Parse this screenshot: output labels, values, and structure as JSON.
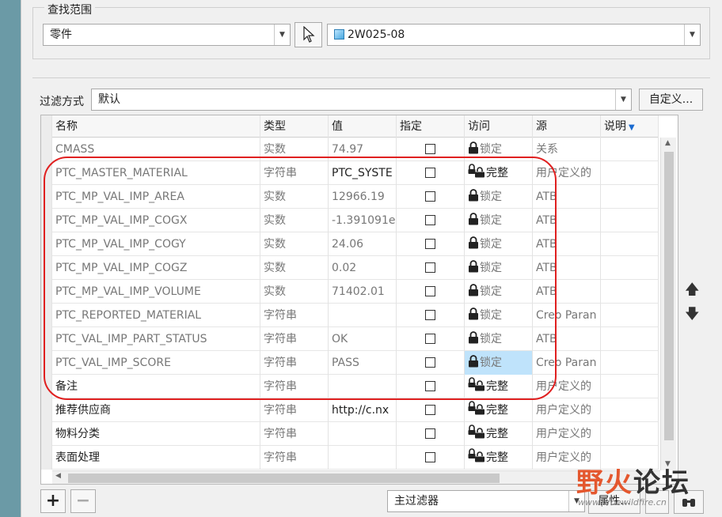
{
  "scope": {
    "legend": "查找范围",
    "type_value": "零件",
    "model_value": "2W025-08"
  },
  "filter": {
    "label": "过滤方式",
    "value": "默认",
    "customize_label": "自定义..."
  },
  "table": {
    "columns": [
      "名称",
      "类型",
      "值",
      "指定",
      "访问",
      "源",
      "说明"
    ],
    "rows": [
      {
        "name": "CMASS",
        "type": "实数",
        "value": "74.97",
        "access": "锁定",
        "locked": true,
        "source": "关系"
      },
      {
        "name": "PTC_MASTER_MATERIAL",
        "type": "字符串",
        "value": "PTC_SYSTE",
        "access": "完整",
        "locked": false,
        "source": "用户定义的"
      },
      {
        "name": "PTC_MP_VAL_IMP_AREA",
        "type": "实数",
        "value": "12966.19",
        "access": "锁定",
        "locked": true,
        "source": "ATB"
      },
      {
        "name": "PTC_MP_VAL_IMP_COGX",
        "type": "实数",
        "value": "-1.391091e",
        "access": "锁定",
        "locked": true,
        "source": "ATB"
      },
      {
        "name": "PTC_MP_VAL_IMP_COGY",
        "type": "实数",
        "value": "24.06",
        "access": "锁定",
        "locked": true,
        "source": "ATB"
      },
      {
        "name": "PTC_MP_VAL_IMP_COGZ",
        "type": "实数",
        "value": "0.02",
        "access": "锁定",
        "locked": true,
        "source": "ATB"
      },
      {
        "name": "PTC_MP_VAL_IMP_VOLUME",
        "type": "实数",
        "value": "71402.01",
        "access": "锁定",
        "locked": true,
        "source": "ATB"
      },
      {
        "name": "PTC_REPORTED_MATERIAL",
        "type": "字符串",
        "value": "",
        "access": "锁定",
        "locked": true,
        "source": "Creo Paran"
      },
      {
        "name": "PTC_VAL_IMP_PART_STATUS",
        "type": "字符串",
        "value": "OK",
        "access": "锁定",
        "locked": true,
        "source": "ATB"
      },
      {
        "name": "PTC_VAL_IMP_SCORE",
        "type": "字符串",
        "value": "PASS",
        "access": "锁定",
        "locked": true,
        "source": "Creo Paran",
        "selected": true
      },
      {
        "name": "备注",
        "type": "字符串",
        "value": "",
        "access": "完整",
        "locked": false,
        "source": "用户定义的"
      },
      {
        "name": "推荐供应商",
        "type": "字符串",
        "value": "http://c.nx",
        "access": "完整",
        "locked": false,
        "source": "用户定义的"
      },
      {
        "name": "物料分类",
        "type": "字符串",
        "value": "",
        "access": "完整",
        "locked": false,
        "source": "用户定义的"
      },
      {
        "name": "表面处理",
        "type": "字符串",
        "value": "",
        "access": "完整",
        "locked": false,
        "source": "用户定义的"
      }
    ]
  },
  "bottom": {
    "filter_select": "主过滤器",
    "properties_label": "属性..."
  },
  "watermark": {
    "text_a": "野火",
    "text_b": "论坛",
    "url": "www.proewildfire.cn"
  }
}
